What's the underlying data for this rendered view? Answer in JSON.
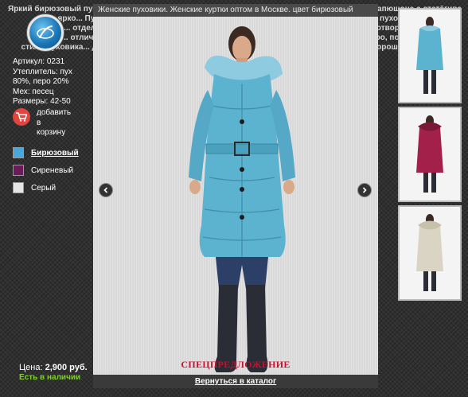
{
  "background_text": [
    "Яркий бирюзовый пуховик с удлинённым силуэтом, отделка натуральным мехом песца на капюшоне с отстёгиванием",
    "ярко... Пушистый мех подчёркивает нежный оттенок изделия, тёплый и модный пуховик",
    "са... отделка... стёганые линии формируют приталенный силуэт, пояс, карманы, отвороты",
    "сдел... отличи... качество пошива, удобная застёжка на кнопки, утеплитель пух и перо, подходит",
    "стиль пуховика... для холодной зимы и повседневного ношения в городе — по рисунку хорошо сочетается",
    "...рую с... ..., ..., ... сапогами и джинсами, ... ... ... ... одежда"
  ],
  "product": {
    "article": "Артикул: 0231",
    "filling_1": "Утеплитель: пух",
    "filling_2": "80%, перо 20%",
    "fur": "Мех: песец",
    "sizes": "Размеры: 42-50",
    "add_to_cart": [
      "добавить",
      "в",
      "корзину"
    ]
  },
  "colors": [
    {
      "label": "Бирюзовый",
      "hex": "#4aa8d8",
      "active": true
    },
    {
      "label": "Сиреневый",
      "hex": "#6b1b5a",
      "active": false
    },
    {
      "label": "Серый",
      "hex": "#e6e6e6",
      "active": false
    }
  ],
  "price": {
    "label": "Цена:",
    "value": "2,900 руб."
  },
  "stock": "Есть в наличии",
  "lightbox": {
    "title": "Женские пуховики. Женские куртки оптом в Москве. цвет бирюзовый",
    "special": "СПЕЦПРЕДЛОЖЕНИЕ",
    "back_link": "Вернуться в каталог",
    "coat_color": "#5cb3cf"
  },
  "thumbnails": [
    {
      "color": "#5cb3cf",
      "name": "turquoise"
    },
    {
      "color": "#a2204a",
      "name": "purple"
    },
    {
      "color": "#d9d4c4",
      "name": "grey"
    }
  ],
  "icons": {
    "logo": "logo-icon",
    "cart": "cart-icon",
    "prev": "chevron-left-icon",
    "next": "chevron-right-icon"
  }
}
